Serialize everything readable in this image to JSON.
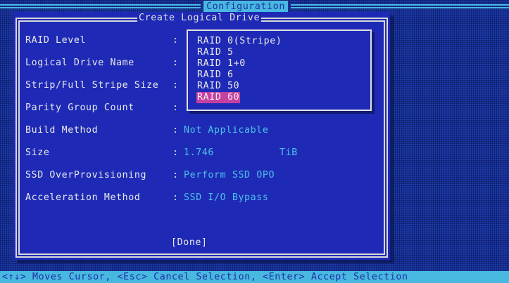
{
  "header": {
    "title": "Configuration"
  },
  "dialog": {
    "title": "Create Logical Drive",
    "fields": [
      {
        "label": "RAID Level",
        "value": ""
      },
      {
        "label": "Logical Drive Name",
        "value": ""
      },
      {
        "label": "Strip/Full Stripe Size",
        "value": ""
      },
      {
        "label": "Parity Group Count",
        "value": ""
      },
      {
        "label": "Build Method",
        "value": "Not Applicable"
      },
      {
        "label": "Size",
        "value": "1.746",
        "unit": "TiB"
      },
      {
        "label": "SSD OverProvisioning",
        "value": "Perform SSD OPO"
      },
      {
        "label": "Acceleration Method",
        "value": "SSD I/O Bypass"
      }
    ],
    "colon": ":",
    "done_label": "[Done]"
  },
  "raid_popup": {
    "options": [
      "RAID 0(Stripe)",
      "RAID 5",
      "RAID 1+0",
      "RAID 6",
      "RAID 50",
      "RAID 60"
    ],
    "selected_index": 5
  },
  "status_bar": {
    "text": "<↑↓> Moves Cursor, <Esc> Cancel Selection, <Enter> Accept Selection"
  },
  "colors": {
    "background": "#1c3aa4",
    "dialog_bg": "#1e2ab6",
    "accent_cyan": "#49b8e0",
    "value_text": "#4ec0e8",
    "highlight": "#c640a0"
  }
}
